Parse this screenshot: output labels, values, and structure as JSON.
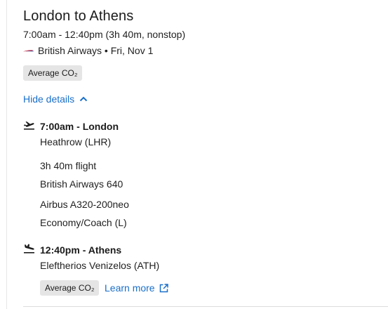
{
  "route": {
    "title": "London to Athens",
    "times": "7:00am - 12:40pm (3h 40m, nonstop)",
    "airline_date": "British Airways • Fri, Nov 1"
  },
  "emissions": {
    "badge_label": "Average CO₂"
  },
  "details_toggle": {
    "label": "Hide details"
  },
  "departure": {
    "heading": "7:00am - London",
    "airport": "Heathrow (LHR)"
  },
  "flight": {
    "duration": "3h 40m flight",
    "flight_number": "British Airways 640",
    "aircraft": "Airbus A320-200neo",
    "cabin": "Economy/Coach (L)"
  },
  "arrival": {
    "heading": "12:40pm - Athens",
    "airport": "Eleftherios Venizelos (ATH)"
  },
  "footer": {
    "badge_label": "Average CO₂",
    "learn_more": "Learn more"
  },
  "colors": {
    "link": "#1a6fc9",
    "badge_bg": "#e5e5e5",
    "airline_mark": "#d4253b"
  },
  "icons": [
    "airline-logo-icon",
    "chevron-up-icon",
    "takeoff-icon",
    "landing-icon",
    "external-link-icon"
  ]
}
